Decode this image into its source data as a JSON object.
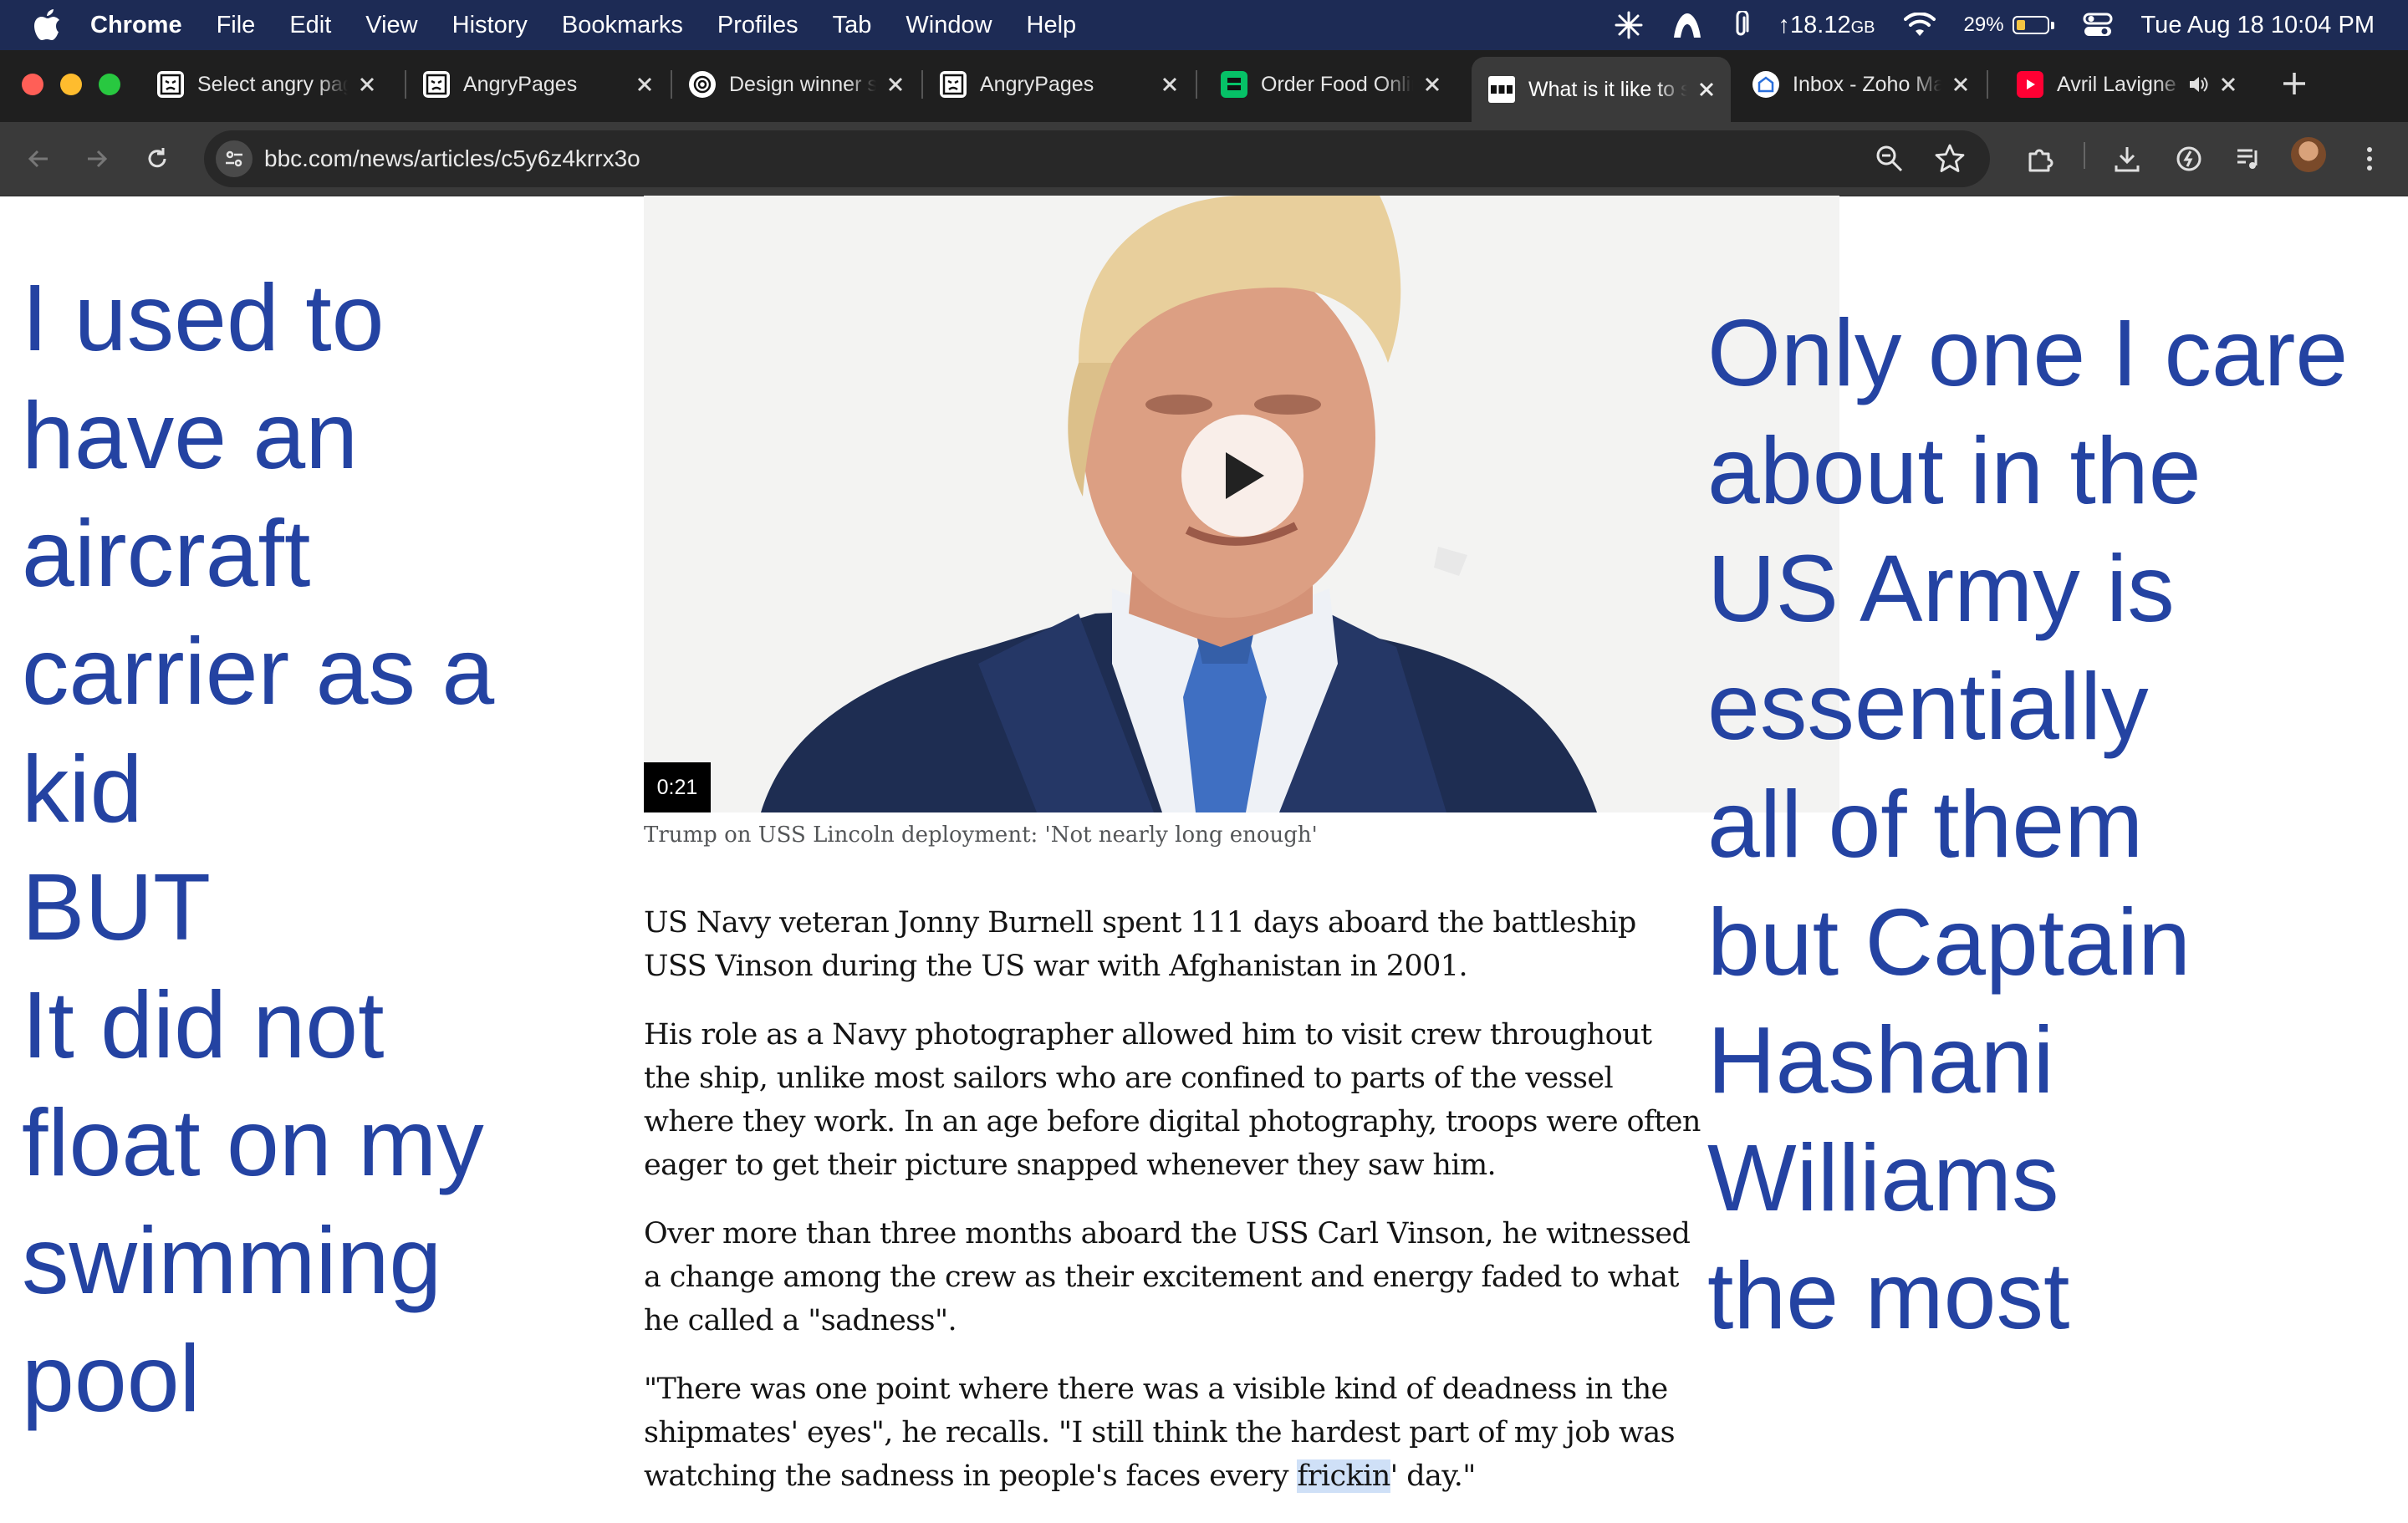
{
  "menubar": {
    "app_name": "Chrome",
    "items": [
      "File",
      "Edit",
      "View",
      "History",
      "Bookmarks",
      "Profiles",
      "Tab",
      "Window",
      "Help"
    ],
    "storage": "↑18.12",
    "storage_unit": "GB",
    "battery": "29%",
    "battery_level": 0.29,
    "datetime": "Tue Aug 18  10:04 PM"
  },
  "tabs": [
    {
      "title": "Select angry pages",
      "favicon": "angrypages-icon",
      "active": false
    },
    {
      "title": "AngryPages",
      "favicon": "angrypages-icon",
      "active": false
    },
    {
      "title": "Design winner selection",
      "favicon": "openai-icon",
      "active": false
    },
    {
      "title": "AngryPages",
      "favicon": "angrypages-icon",
      "active": false
    },
    {
      "title": "Order Food Online",
      "favicon": "ubereats-icon",
      "active": false
    },
    {
      "title": "What is it like to serve",
      "favicon": "bbc-icon",
      "active": true
    },
    {
      "title": "Inbox - Zoho Mail",
      "favicon": "zoho-icon",
      "active": false
    },
    {
      "title": "Avril Lavigne",
      "favicon": "youtube-icon",
      "active": false
    }
  ],
  "omnibox": {
    "url": "bbc.com/news/articles/c5y6z4krrx3o"
  },
  "overlay": {
    "left_text": "I used to\nhave an\naircraft\ncarrier as a\nkid\nBUT\nIt did not\nfloat on my\nswimming\npool",
    "right_text": "Only one I care\nabout in the\nUS Army is\nessentially\nall of them\nbut Captain\nHashani\nWilliams\nthe most"
  },
  "video": {
    "duration": "0:21",
    "caption": "Trump on USS Lincoln deployment: 'Not nearly long enough'"
  },
  "article": {
    "p1": "US Navy veteran Jonny Burnell spent 111 days aboard the battleship USS Vinson during the US war with Afghanistan in 2001.",
    "p2": "His role as a Navy photographer allowed him to visit crew throughout the ship, unlike most sailors who are confined to parts of the vessel where they work. In an age before digital photography, troops were often eager to get their picture snapped whenever they saw him.",
    "p3": "Over more than three months aboard the USS Carl Vinson, he witnessed a change among the crew as their excitement and energy faded to what he called a \"sadness\".",
    "p4_before": "\"There was one point where there was a visible kind of deadness in the shipmates' eyes\", he recalls. \"I still think the hardest part of my job was watching the sadness in people's faces every ",
    "p4_highlight": "frickin",
    "p4_after": "' day.\""
  },
  "colors": {
    "menubar_bg": "#1d2b55",
    "overlay_text": "#2443a2",
    "tab_active_bg": "#3a3a3a"
  }
}
